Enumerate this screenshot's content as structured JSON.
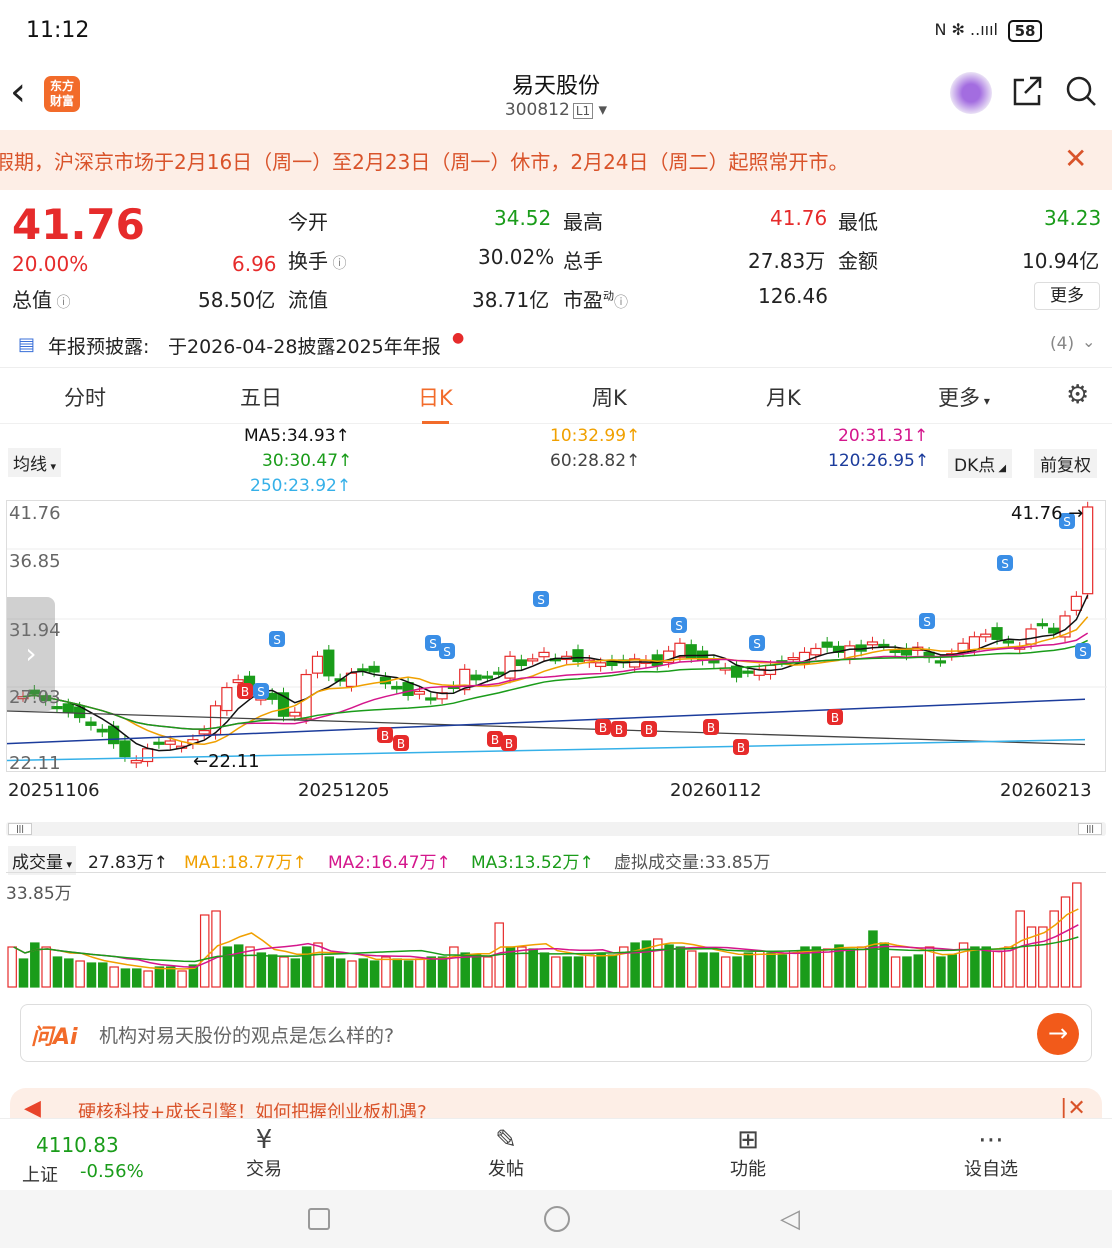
{
  "status": {
    "time": "11:12",
    "icons": "N ✻ ..ıııl",
    "battery": "58"
  },
  "header": {
    "title": "易天股份",
    "code": "300812",
    "level": "L1",
    "logo_line1": "东方",
    "logo_line2": "财富"
  },
  "notice": {
    "text": "假期，沪深京市场于2月16日（周一）至2月23日（周一）休市，2月24日（周二）起照常开市。"
  },
  "quote": {
    "price": "41.76",
    "change_pct": "20.00%",
    "change": "6.96",
    "open_label": "今开",
    "open": "34.52",
    "high_label": "最高",
    "high": "41.76",
    "low_label": "最低",
    "low": "34.23",
    "turnover_label": "换手",
    "turnover": "30.02%",
    "vol_label": "总手",
    "vol": "27.83万",
    "amount_label": "金额",
    "amount": "10.94亿",
    "mcap_label": "总值",
    "mcap": "58.50亿",
    "float_label": "流值",
    "float": "38.71亿",
    "pe_label": "市盈",
    "pe_sup": "动",
    "pe": "126.46",
    "more": "更多"
  },
  "report": {
    "text": "年报预披露:",
    "detail": "于2026-04-28披露2025年年报",
    "count": "(4)"
  },
  "tabs": [
    "分时",
    "五日",
    "日K",
    "周K",
    "月K",
    "更多"
  ],
  "active_tab": "日K",
  "ma": {
    "selector": "均线",
    "ma5": "MA5:34.93↑",
    "ma10": "10:32.99↑",
    "ma20": "20:31.31↑",
    "ma30": "30:30.47↑",
    "ma60": "60:28.82↑",
    "ma120": "120:26.95↑",
    "ma250": "250:23.92↑",
    "dk": "DK点",
    "fq": "前复权"
  },
  "chart_data": {
    "type": "candlestick",
    "yticks": [
      "41.76",
      "36.85",
      "31.94",
      "27.03",
      "22.11"
    ],
    "xticks": [
      "20251106",
      "20251205",
      "20260112",
      "20260213"
    ],
    "max_label": "41.76",
    "min_label": "22.11",
    "ylim": [
      22.11,
      41.76
    ]
  },
  "volume": {
    "selector": "成交量",
    "vol": "27.83万↑",
    "ma1": "MA1:18.77万↑",
    "ma2": "MA2:16.47万↑",
    "ma3": "MA3:13.52万↑",
    "virtual": "虚拟成交量:33.85万",
    "max": "33.85万"
  },
  "ai": {
    "logo": "问Ai",
    "placeholder": "机构对易天股份的观点是怎么样的?"
  },
  "ad": {
    "text": "硬核科技+成长引擎！如何把握创业板机遇?"
  },
  "bottom": {
    "index_value": "4110.83",
    "index_name": "上证",
    "index_change": "-0.56%",
    "trade": "交易",
    "post": "发帖",
    "func": "功能",
    "watch": "设自选"
  },
  "colors": {
    "up": "#e62b2b",
    "down": "#1a9c1a",
    "accent": "#f26b2a"
  }
}
